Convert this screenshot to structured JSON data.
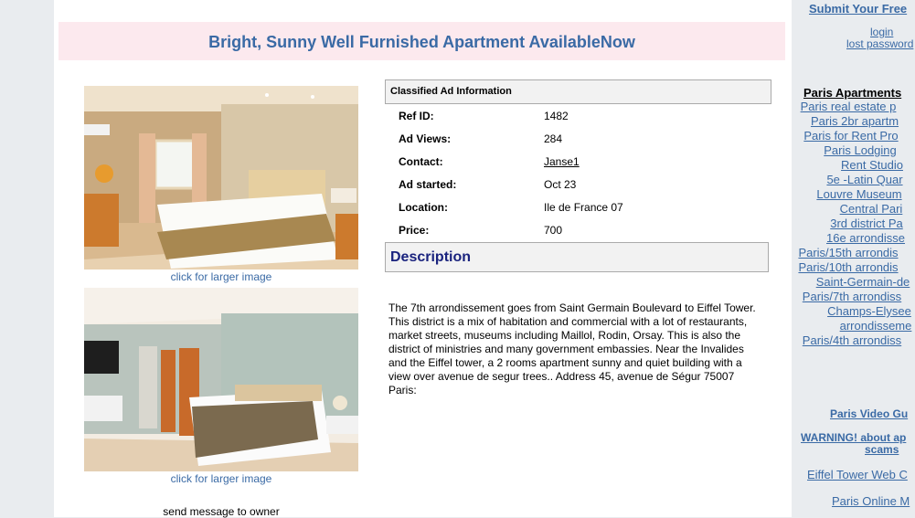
{
  "ad": {
    "title": "Bright, Sunny Well Furnished Apartment AvailableNow",
    "larger_image_label": "click for larger image",
    "send_message_label": "send message to owner",
    "info_header": "Classified Ad Information",
    "fields": [
      {
        "label": "Ref ID:",
        "value": "1482"
      },
      {
        "label": "Ad Views:",
        "value": "284"
      },
      {
        "label": "Contact:",
        "value": "Janse1"
      },
      {
        "label": "Ad started:",
        "value": "Oct 23"
      },
      {
        "label": "Location:",
        "value": "Ile de France 07"
      },
      {
        "label": "Price:",
        "value": "700"
      }
    ],
    "description_header": "Description",
    "description": "The 7th arrondissement goes from Saint Germain Boulevard to Eiffel Tower. This district is a mix of habitation and commercial with a lot of restaurants, market streets, museums including Maillol, Rodin, Orsay. This is also the district of ministries and many government embassies. Near the Invalides and the Eiffel tower, a 2 rooms apartment sunny and quiet building with a view over avenue de segur trees.. Address 45, avenue de Ségur 75007 Paris:"
  },
  "sidebar": {
    "submit": "Submit Your Free",
    "login": "login",
    "lost_password": "lost password",
    "apartments_heading": "Paris Apartments",
    "apartment_links": [
      "Paris real estate p",
      "Paris 2br apartm",
      "Paris for Rent Pro",
      "Paris Lodging",
      "Rent Studio",
      "5e -Latin Quar",
      "Louvre Museum",
      "Central Pari",
      "3rd district Pa",
      "16e arrondisse",
      "Paris/15th arrondis",
      "Paris/10th arrondis",
      "Saint-Germain-de",
      "Paris/7th arrondiss",
      "Champs-Elysee",
      "arrondisseme",
      "Paris/4th arrondiss"
    ],
    "video_guide": "Paris Video Gu",
    "warning_line1": "WARNING! about ap",
    "warning_line2": "scams",
    "eiffel": "Eiffel Tower Web C",
    "online": "Paris Online M"
  },
  "colors": {
    "link": "#3a6aa5",
    "title_bg": "#fce9ee",
    "desc_header": "#1a237e",
    "panel_bg": "#f2f2f2"
  }
}
